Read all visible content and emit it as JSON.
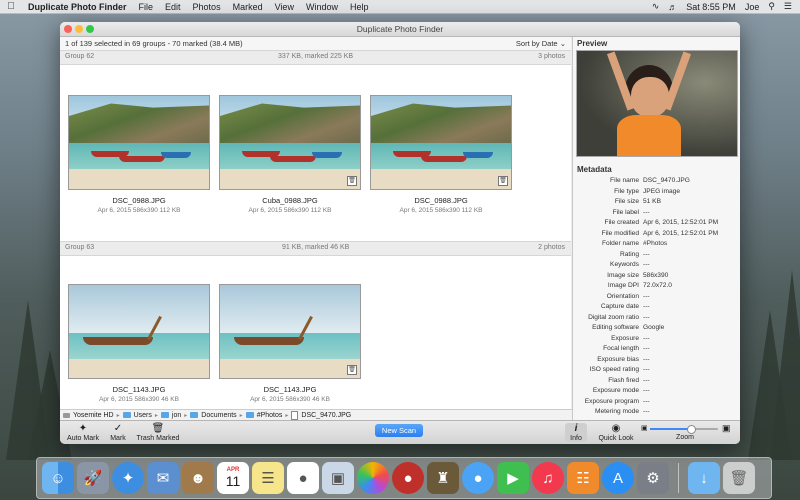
{
  "menubar": {
    "app_name": "Duplicate Photo Finder",
    "items": [
      "File",
      "Edit",
      "Photos",
      "Marked",
      "View",
      "Window",
      "Help"
    ],
    "clock": "Sat 8:55 PM",
    "user": "Joe"
  },
  "window": {
    "title": "Duplicate Photo Finder",
    "status": "1 of 139 selected in 69 groups - 70 marked (38.4 MB)",
    "sort_label": "Sort by Date"
  },
  "groups": [
    {
      "name": "Group 62",
      "size": "337 KB, marked 225 KB",
      "count": "3 photos",
      "photos": [
        {
          "name": "DSC_0988.JPG",
          "meta": "Apr 6, 2015   586x390   112 KB"
        },
        {
          "name": "Cuba_0988.JPG",
          "meta": "Apr 6, 2015   586x390   112 KB"
        },
        {
          "name": "DSC_0988.JPG",
          "meta": "Apr 6, 2015   586x390   112 KB"
        }
      ]
    },
    {
      "name": "Group 63",
      "size": "91 KB, marked 46 KB",
      "count": "2 photos",
      "photos": [
        {
          "name": "DSC_1143.JPG",
          "meta": "Apr 6, 2015   586x390   46 KB"
        },
        {
          "name": "DSC_1143.JPG",
          "meta": "Apr 6, 2015   586x390   46 KB"
        }
      ]
    }
  ],
  "path": [
    "Yosemite HD",
    "Users",
    "jon",
    "Documents",
    "#Photos",
    "DSC_9470.JPG"
  ],
  "side": {
    "preview_label": "Preview",
    "metadata_label": "Metadata",
    "metadata": [
      {
        "k": "File name",
        "v": "DSC_9470.JPG"
      },
      {
        "k": "File type",
        "v": "JPEG image"
      },
      {
        "k": "File size",
        "v": "51 KB"
      },
      {
        "k": "File label",
        "v": "---"
      },
      {
        "k": "File created",
        "v": "Apr 6, 2015, 12:52:01 PM"
      },
      {
        "k": "File modified",
        "v": "Apr 6, 2015, 12:52:01 PM"
      },
      {
        "k": "Folder name",
        "v": "#Photos"
      },
      {
        "k": "Rating",
        "v": "---"
      },
      {
        "k": "Keywords",
        "v": "---"
      },
      {
        "k": "Image size",
        "v": "586x390"
      },
      {
        "k": "Image DPI",
        "v": "72.0x72.0"
      },
      {
        "k": "Orientation",
        "v": "---"
      },
      {
        "k": "Capture date",
        "v": "---"
      },
      {
        "k": "Digital zoom ratio",
        "v": "---"
      },
      {
        "k": "Editing software",
        "v": "Google"
      },
      {
        "k": "Exposure",
        "v": "---"
      },
      {
        "k": "Focal length",
        "v": "---"
      },
      {
        "k": "Exposure bias",
        "v": "---"
      },
      {
        "k": "ISO speed rating",
        "v": "---"
      },
      {
        "k": "Flash fired",
        "v": "---"
      },
      {
        "k": "Exposure mode",
        "v": "---"
      },
      {
        "k": "Exposure program",
        "v": "---"
      },
      {
        "k": "Metering mode",
        "v": "---"
      }
    ]
  },
  "toolbar": {
    "auto_mark": "Auto Mark",
    "mark": "Mark",
    "trash_marked": "Trash Marked",
    "new_scan": "New Scan",
    "info": "Info",
    "quick_look": "Quick Look",
    "zoom": "Zoom",
    "zoom_level": 0.6
  },
  "dock_icons": [
    "finder-icon",
    "launchpad-icon",
    "safari-icon",
    "mail-icon",
    "contacts-icon",
    "calendar-icon",
    "notes-icon",
    "reminders-icon",
    "preview-icon",
    "photos-icon",
    "photo-booth-icon",
    "game-icon",
    "messages-icon",
    "facetime-icon",
    "music-icon",
    "books-icon",
    "app-store-icon",
    "system-preferences-icon",
    "downloads-icon",
    "trash-icon"
  ],
  "calendar_date": {
    "month": "APR",
    "day": "11"
  },
  "colors": {
    "accent": "#2b7ff0",
    "folder": "#58a6e8"
  }
}
